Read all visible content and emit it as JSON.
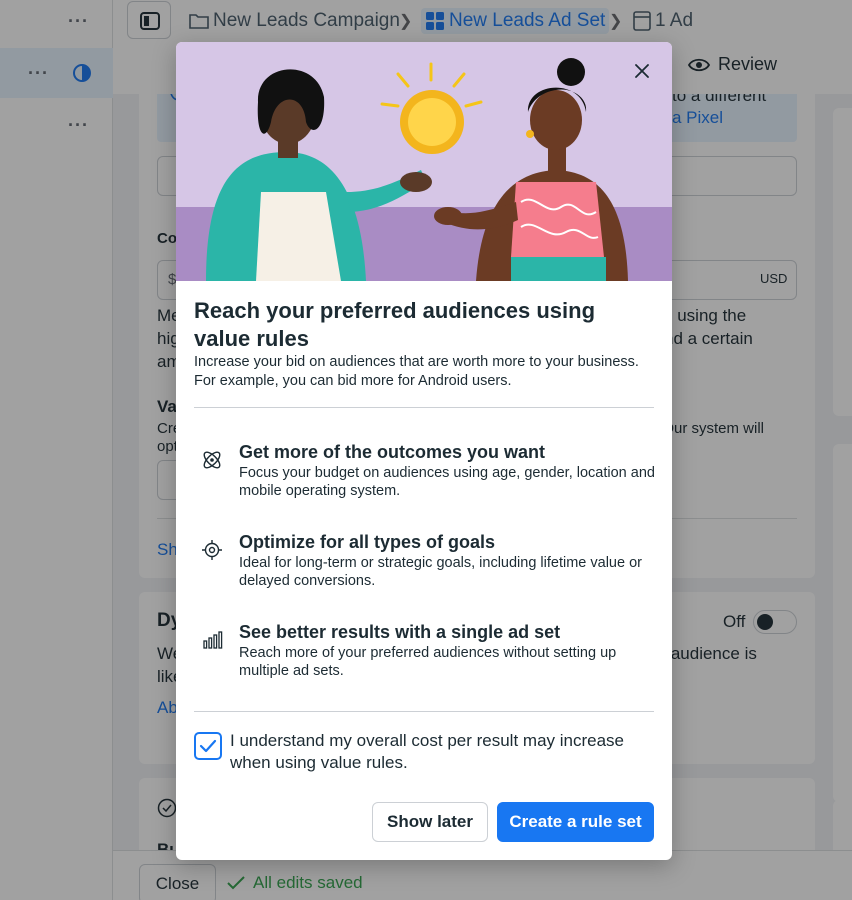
{
  "breadcrumb": {
    "campaign": "New Leads Campaign",
    "ad_set": "New Leads Ad Set",
    "ad": "1 Ad"
  },
  "tabs": {
    "review": "Review"
  },
  "background": {
    "info_line_1": "to a different",
    "info_link": "a Pixel",
    "section_label_fragment": "Co",
    "currency_symbol": "$",
    "currency_code": "USD",
    "text_frag_1a": "Me",
    "text_frag_1b": "s using the",
    "text_frag_2a": "hig",
    "text_frag_2b": "nd a certain",
    "text_frag_3a": "am",
    "value_label_fragment": "Va",
    "small_frag_a": "Cre",
    "small_frag_b": "ss. Our system will",
    "small_frag_c": "opt",
    "show_link_fragment": "Sh",
    "dyn_label_fragment": "Dy",
    "toggle_state": "Off",
    "dyn_text_a": "We",
    "dyn_text_b": "ur audience is",
    "dyn_text_c": "like",
    "dyn_link_fragment": "Ab",
    "budget_label_fragment": "Bu"
  },
  "footer": {
    "close_label": "Close",
    "saved_status": "All edits saved"
  },
  "modal": {
    "title": "Reach your preferred audiences using value rules",
    "description": "Increase your bid on audiences that are worth more to your business. For example, you can bid more for Android users.",
    "features": [
      {
        "icon": "atom-icon",
        "title": "Get more of the outcomes you want",
        "description": "Focus your budget on audiences using age, gender, location and mobile operating system."
      },
      {
        "icon": "target-icon",
        "title": "Optimize for all types of goals",
        "description": "Ideal for long-term or strategic goals, including lifetime value or delayed conversions."
      },
      {
        "icon": "bar-chart-icon",
        "title": "See better results with a single ad set",
        "description": "Reach more of your preferred audiences without setting up multiple ad sets."
      }
    ],
    "acknowledgement": "I understand my overall cost per result may increase when using value rules.",
    "acknowledgement_checked": true,
    "show_later_label": "Show later",
    "create_label": "Create a rule set"
  },
  "colors": {
    "accent": "#1877f2",
    "hero_background": "#d6c6e6",
    "success": "#31a24c"
  }
}
